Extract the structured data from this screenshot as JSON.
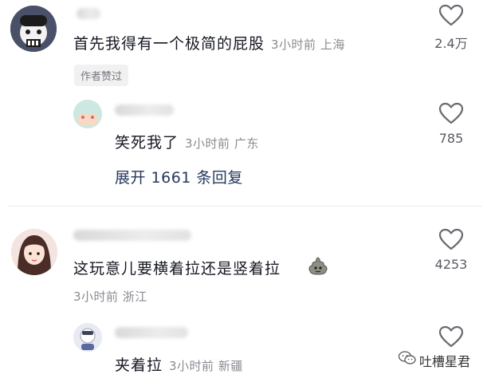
{
  "comments": [
    {
      "text": "首先我得有一个极简的屁股",
      "meta": "3小时前 上海",
      "likes": "2.4万",
      "badge": "作者赞过",
      "replies": [
        {
          "text": "笑死我了",
          "meta": "3小时前 广东",
          "likes": "785"
        }
      ],
      "expand_label": "展开 1661 条回复"
    },
    {
      "text": "这玩意儿要横着拉还是竖着拉",
      "meta": "3小时前 浙江",
      "likes": "4253",
      "replies": [
        {
          "text": "夹着拉",
          "meta": "3小时前 新疆",
          "likes": ""
        }
      ]
    }
  ],
  "watermark": {
    "text": "吐槽星君"
  },
  "icons": {
    "like": "heart-outline-icon",
    "emoji": "poop-emoji-icon",
    "watermark": "wechat-icon"
  }
}
